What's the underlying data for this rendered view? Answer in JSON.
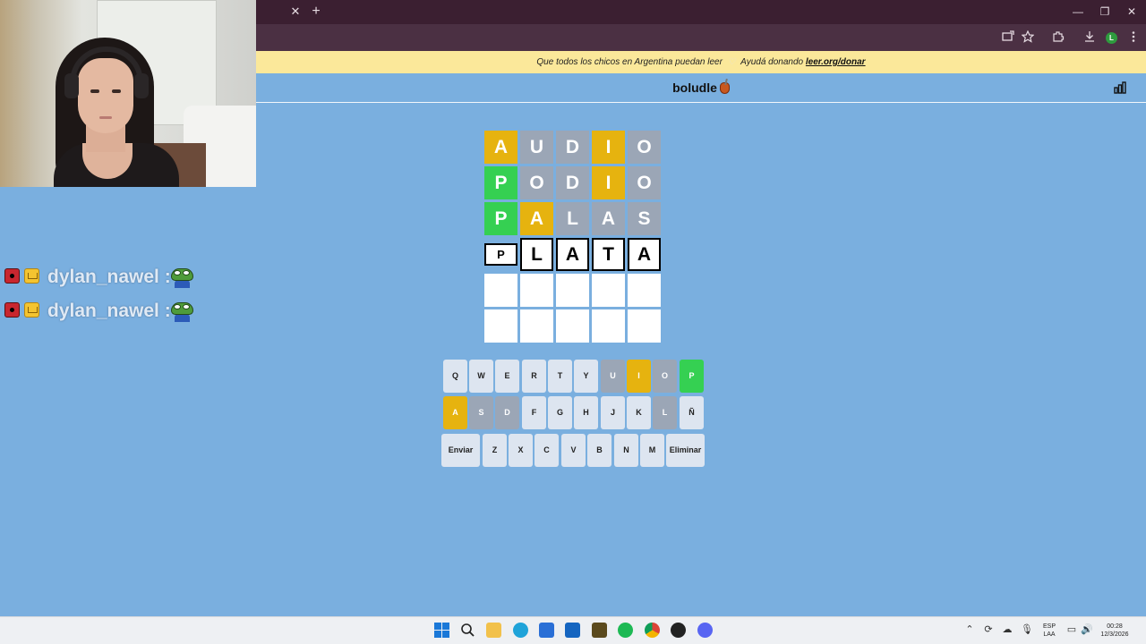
{
  "browser": {
    "close_tab_glyph": "✕",
    "new_tab_glyph": "+",
    "minimize_glyph": "—",
    "restore_glyph": "❐",
    "close_glyph": "✕",
    "profile_initial": "L"
  },
  "banner": {
    "text": "Que todos los chicos en Argentina puedan leer",
    "heart": "♡",
    "cta_text": "Ayudá donando",
    "link": "leer.org/donar"
  },
  "app": {
    "title": "boludle"
  },
  "board": {
    "rows": [
      [
        {
          "letter": "A",
          "state": "present"
        },
        {
          "letter": "U",
          "state": "absent"
        },
        {
          "letter": "D",
          "state": "absent"
        },
        {
          "letter": "I",
          "state": "present"
        },
        {
          "letter": "O",
          "state": "absent"
        }
      ],
      [
        {
          "letter": "P",
          "state": "correct"
        },
        {
          "letter": "O",
          "state": "absent"
        },
        {
          "letter": "D",
          "state": "absent"
        },
        {
          "letter": "I",
          "state": "present"
        },
        {
          "letter": "O",
          "state": "absent"
        }
      ],
      [
        {
          "letter": "P",
          "state": "correct"
        },
        {
          "letter": "A",
          "state": "present"
        },
        {
          "letter": "L",
          "state": "absent"
        },
        {
          "letter": "A",
          "state": "absent"
        },
        {
          "letter": "S",
          "state": "absent"
        }
      ],
      [
        {
          "letter": "P",
          "state": "typed"
        },
        {
          "letter": "L",
          "state": "typed"
        },
        {
          "letter": "A",
          "state": "typed"
        },
        {
          "letter": "T",
          "state": "typed"
        },
        {
          "letter": "A",
          "state": "typed"
        }
      ],
      [
        {
          "letter": "",
          "state": "empty"
        },
        {
          "letter": "",
          "state": "empty"
        },
        {
          "letter": "",
          "state": "empty"
        },
        {
          "letter": "",
          "state": "empty"
        },
        {
          "letter": "",
          "state": "empty"
        }
      ],
      [
        {
          "letter": "",
          "state": "empty"
        },
        {
          "letter": "",
          "state": "empty"
        },
        {
          "letter": "",
          "state": "empty"
        },
        {
          "letter": "",
          "state": "empty"
        },
        {
          "letter": "",
          "state": "empty"
        }
      ]
    ]
  },
  "keyboard": {
    "rows": [
      [
        {
          "label": "Q",
          "state": "default"
        },
        {
          "label": "W",
          "state": "default"
        },
        {
          "label": "E",
          "state": "default"
        },
        {
          "label": "R",
          "state": "default"
        },
        {
          "label": "T",
          "state": "default"
        },
        {
          "label": "Y",
          "state": "default"
        },
        {
          "label": "U",
          "state": "absent"
        },
        {
          "label": "I",
          "state": "present"
        },
        {
          "label": "O",
          "state": "absent"
        },
        {
          "label": "P",
          "state": "correct"
        }
      ],
      [
        {
          "label": "A",
          "state": "present"
        },
        {
          "label": "S",
          "state": "absent"
        },
        {
          "label": "D",
          "state": "absent"
        },
        {
          "label": "F",
          "state": "default"
        },
        {
          "label": "G",
          "state": "default"
        },
        {
          "label": "H",
          "state": "default"
        },
        {
          "label": "J",
          "state": "default"
        },
        {
          "label": "K",
          "state": "default"
        },
        {
          "label": "L",
          "state": "absent"
        },
        {
          "label": "Ñ",
          "state": "default"
        }
      ],
      [
        {
          "label": "Enviar",
          "state": "default"
        },
        {
          "label": "Z",
          "state": "default"
        },
        {
          "label": "X",
          "state": "default"
        },
        {
          "label": "C",
          "state": "default"
        },
        {
          "label": "V",
          "state": "default"
        },
        {
          "label": "B",
          "state": "default"
        },
        {
          "label": "N",
          "state": "default"
        },
        {
          "label": "M",
          "state": "default"
        },
        {
          "label": "Eliminar",
          "state": "default"
        }
      ]
    ]
  },
  "chat": {
    "messages": [
      {
        "user": "dylan_nawel :",
        "emote": "pepe"
      },
      {
        "user": "dylan_nawel :",
        "emote": "pepe"
      }
    ]
  },
  "taskbar": {
    "language_top": "ESP",
    "language_bottom": "LAA",
    "time": "00:28",
    "date": "12/3/2026"
  },
  "colors": {
    "correct": "#35d052",
    "present": "#e6b30f",
    "absent": "#9ba6b6",
    "page_background": "#7aafdf",
    "banner_background": "#fbe89a"
  }
}
